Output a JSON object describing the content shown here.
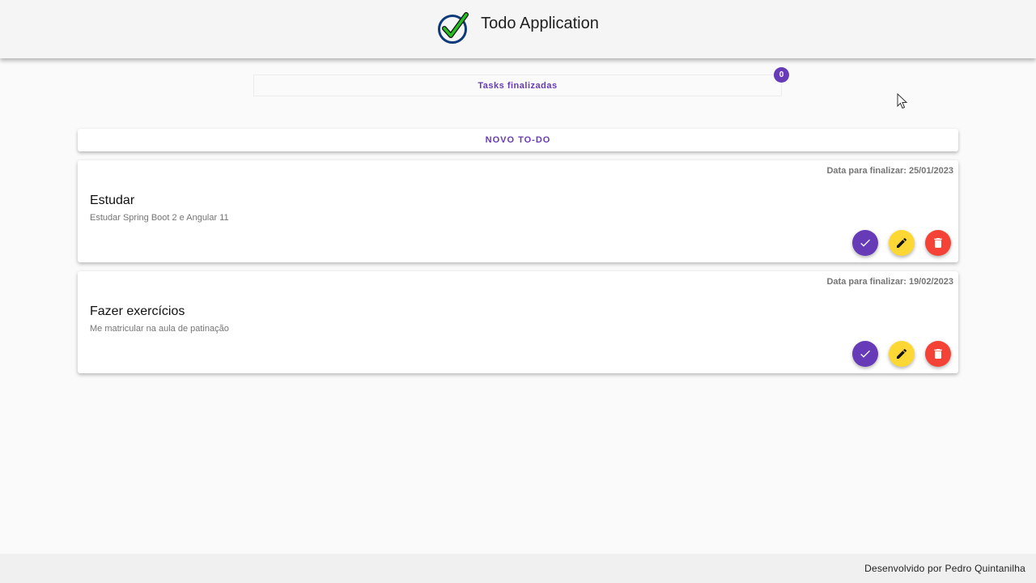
{
  "header": {
    "title": "Todo Application",
    "logo_icon": "check-circle-icon"
  },
  "finished": {
    "label": "Tasks finalizadas",
    "count": "0"
  },
  "new_todo": {
    "label": "NOVO TO-DO"
  },
  "todos": [
    {
      "date": "Data para finalizar: 25/01/2023",
      "title": "Estudar",
      "description": "Estudar Spring Boot 2 e Angular 11"
    },
    {
      "date": "Data para finalizar: 19/02/2023",
      "title": "Fazer exercícios",
      "description": "Me matricular na aula de patinação"
    }
  ],
  "footer": {
    "text": "Desenvolvido por Pedro Quintanilha"
  },
  "colors": {
    "primary": "#673ab7",
    "accent": "#fdd835",
    "warn": "#f44336"
  }
}
